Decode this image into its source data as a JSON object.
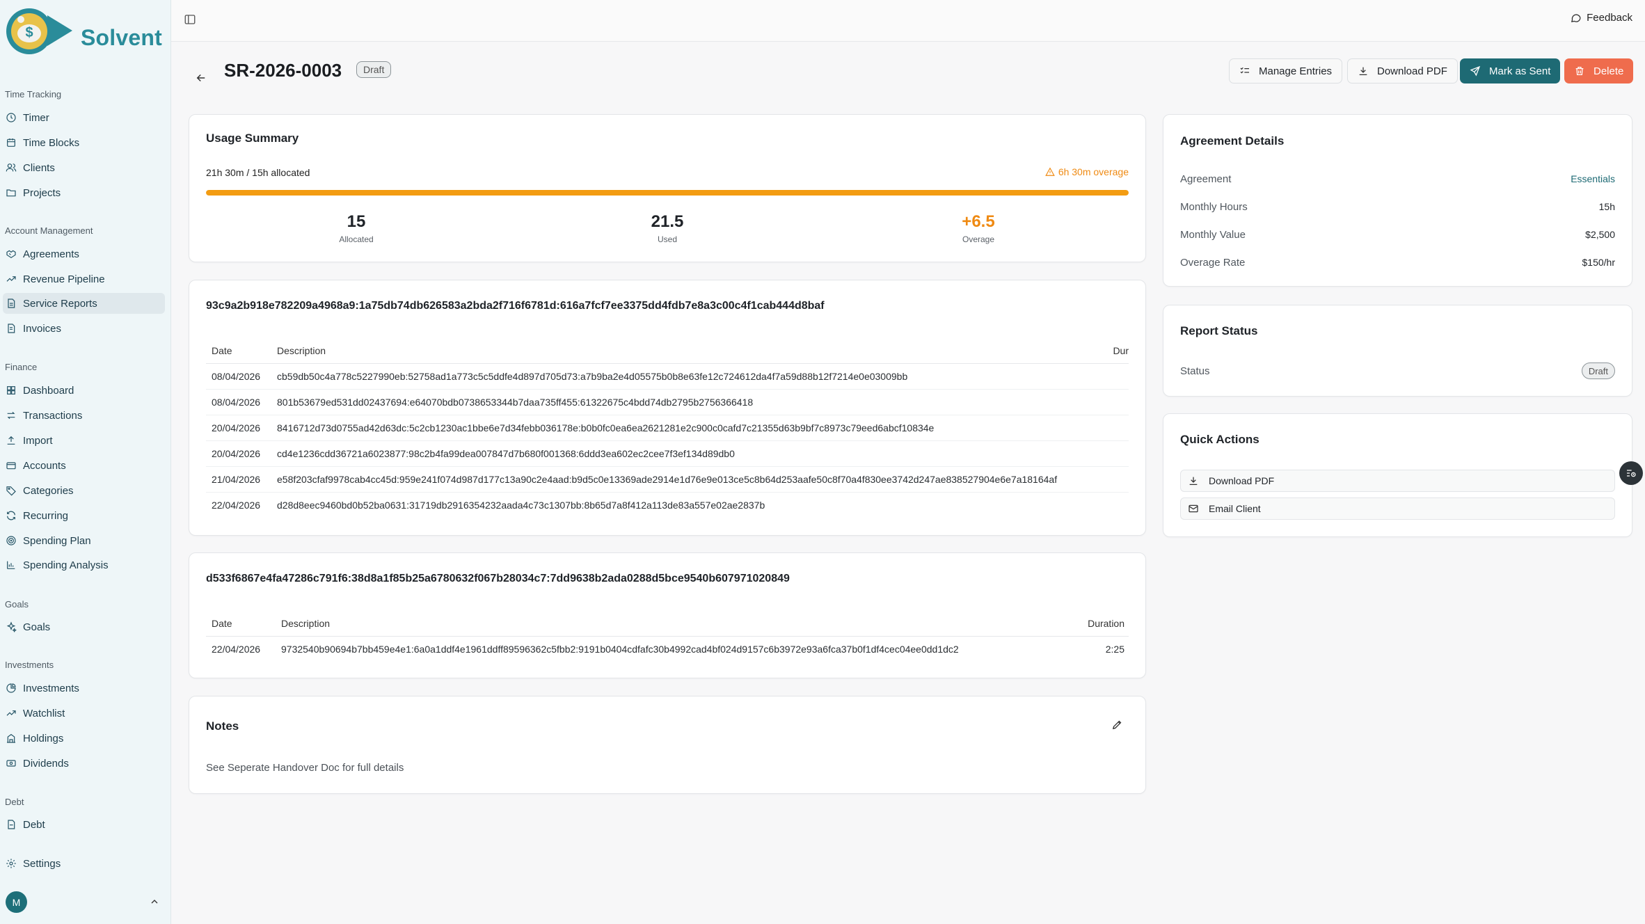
{
  "brand": {
    "name": "Solvent"
  },
  "sidebar": {
    "sections": [
      {
        "label": "Time Tracking",
        "items": [
          "Timer",
          "Time Blocks",
          "Clients",
          "Projects"
        ]
      },
      {
        "label": "Account Management",
        "items": [
          "Agreements",
          "Revenue Pipeline",
          "Service Reports",
          "Invoices"
        ]
      },
      {
        "label": "Finance",
        "items": [
          "Dashboard",
          "Transactions",
          "Import",
          "Accounts",
          "Categories",
          "Recurring",
          "Spending Plan",
          "Spending Analysis"
        ]
      },
      {
        "label": "Goals",
        "items": [
          "Goals"
        ]
      },
      {
        "label": "Investments",
        "items": [
          "Investments",
          "Watchlist",
          "Holdings",
          "Dividends"
        ]
      },
      {
        "label": "Debt",
        "items": [
          "Debt"
        ]
      }
    ],
    "settings_label": "Settings",
    "avatar_initial": "M",
    "active_item": "Service Reports"
  },
  "topbar": {
    "feedback_label": "Feedback"
  },
  "header": {
    "title": "SR-2026-0003",
    "status_badge": "Draft",
    "buttons": {
      "manage_entries": "Manage Entries",
      "download_pdf": "Download PDF",
      "mark_as_sent": "Mark as Sent",
      "delete": "Delete"
    }
  },
  "usage": {
    "title": "Usage Summary",
    "summary_line": "21h 30m / 15h allocated",
    "overage_note": "6h 30m overage",
    "progress_fraction": 1.0,
    "stats": [
      {
        "value": "15",
        "label": "Allocated"
      },
      {
        "value": "21.5",
        "label": "Used"
      },
      {
        "value": "+6.5",
        "label": "Overage"
      }
    ]
  },
  "entry_groups": [
    {
      "title": "93c9a2b918e782209a4968a9:1a75db74db626583a2bda2f716f6781d:616a7fcf7ee3375dd4fdb7e8a3c00c4f1cab444d8baf",
      "columns": [
        "Date",
        "Description",
        "Dur"
      ],
      "rows": [
        [
          "08/04/2026",
          "cb59db50c4a778c5227990eb:52758ad1a773c5c5ddfe4d897d705d73:a7b9ba2e4d05575b0b8e63fe12c724612da4f7a59d88b12f7214e0e03009bb",
          ""
        ],
        [
          "08/04/2026",
          "801b53679ed531dd02437694:e64070bdb0738653344b7daa735ff455:61322675c4bdd74db2795b2756366418",
          ""
        ],
        [
          "20/04/2026",
          "8416712d73d0755ad42d63dc:5c2cb1230ac1bbe6e7d34febb036178e:b0b0fc0ea6ea2621281e2c900c0cafd7c21355d63b9bf7c8973c79eed6abcf10834e",
          ""
        ],
        [
          "20/04/2026",
          "cd4e1236cdd36721a6023877:98c2b4fa99dea007847d7b680f001368:6ddd3ea602ec2cee7f3ef134d89db0",
          ""
        ],
        [
          "21/04/2026",
          "e58f203cfaf9978cab4cc45d:959e241f074d987d177c13a90c2e4aad:b9d5c0e13369ade2914e1d76e9e013ce5c8b64d253aafe50c8f70a4f830ee3742d247ae838527904e6e7a18164af",
          ""
        ],
        [
          "22/04/2026",
          "d28d8eec9460bd0b52ba0631:31719db2916354232aada4c73c1307bb:8b65d7a8f412a113de83a557e02ae2837b",
          ""
        ]
      ]
    },
    {
      "title": "d533f6867e4fa47286c791f6:38d8a1f85b25a6780632f067b28034c7:7dd9638b2ada0288d5bce9540b607971020849",
      "columns": [
        "Date",
        "Description",
        "Duration"
      ],
      "rows": [
        [
          "22/04/2026",
          "9732540b90694b7bb459e4e1:6a0a1ddf4e1961ddff89596362c5fbb2:9191b0404cdfafc30b4992cad4bf024d9157c6b3972e93a6fca37b0f1df4cec04ee0dd1dc2",
          "2:25"
        ]
      ]
    }
  ],
  "notes": {
    "title": "Notes",
    "text": "See Seperate Handover Doc for full details"
  },
  "agreement_details": {
    "title": "Agreement Details",
    "rows": [
      {
        "key": "Agreement",
        "value": "Essentials"
      },
      {
        "key": "Monthly Hours",
        "value": "15h"
      },
      {
        "key": "Monthly Value",
        "value": "$2,500"
      },
      {
        "key": "Overage Rate",
        "value": "$150/hr"
      }
    ]
  },
  "report_status": {
    "title": "Report Status",
    "key": "Status",
    "value": "Draft"
  },
  "quick_actions": {
    "title": "Quick Actions",
    "items": [
      "Download PDF",
      "Email Client"
    ]
  },
  "colors": {
    "brand": "#2a8c9a",
    "primary": "#1e6a74",
    "danger": "#ef6c4d",
    "warning": "#f39c12"
  }
}
